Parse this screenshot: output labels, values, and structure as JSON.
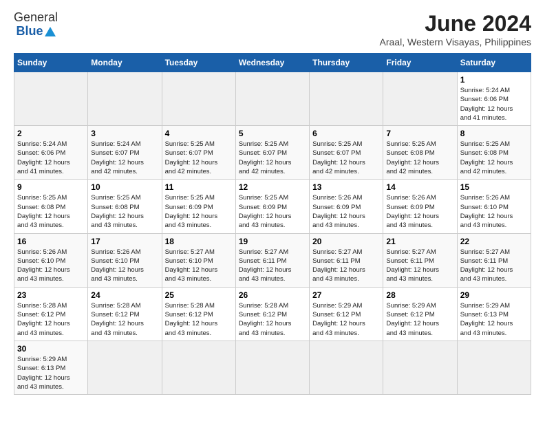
{
  "header": {
    "logo_general": "General",
    "logo_blue": "Blue",
    "title": "June 2024",
    "subtitle": "Araal, Western Visayas, Philippines"
  },
  "days_of_week": [
    "Sunday",
    "Monday",
    "Tuesday",
    "Wednesday",
    "Thursday",
    "Friday",
    "Saturday"
  ],
  "weeks": [
    {
      "days": [
        {
          "number": "",
          "empty": true
        },
        {
          "number": "",
          "empty": true
        },
        {
          "number": "",
          "empty": true
        },
        {
          "number": "",
          "empty": true
        },
        {
          "number": "",
          "empty": true
        },
        {
          "number": "",
          "empty": true
        },
        {
          "number": "1",
          "sunrise": "5:24 AM",
          "sunset": "6:06 PM",
          "daylight_hours": "12",
          "daylight_minutes": "41"
        }
      ]
    },
    {
      "days": [
        {
          "number": "2",
          "sunrise": "5:24 AM",
          "sunset": "6:06 PM",
          "daylight_hours": "12",
          "daylight_minutes": "41"
        },
        {
          "number": "3",
          "sunrise": "5:24 AM",
          "sunset": "6:07 PM",
          "daylight_hours": "12",
          "daylight_minutes": "42"
        },
        {
          "number": "4",
          "sunrise": "5:25 AM",
          "sunset": "6:07 PM",
          "daylight_hours": "12",
          "daylight_minutes": "42"
        },
        {
          "number": "5",
          "sunrise": "5:25 AM",
          "sunset": "6:07 PM",
          "daylight_hours": "12",
          "daylight_minutes": "42"
        },
        {
          "number": "6",
          "sunrise": "5:25 AM",
          "sunset": "6:07 PM",
          "daylight_hours": "12",
          "daylight_minutes": "42"
        },
        {
          "number": "7",
          "sunrise": "5:25 AM",
          "sunset": "6:08 PM",
          "daylight_hours": "12",
          "daylight_minutes": "42"
        },
        {
          "number": "8",
          "sunrise": "5:25 AM",
          "sunset": "6:08 PM",
          "daylight_hours": "12",
          "daylight_minutes": "42"
        }
      ]
    },
    {
      "days": [
        {
          "number": "9",
          "sunrise": "5:25 AM",
          "sunset": "6:08 PM",
          "daylight_hours": "12",
          "daylight_minutes": "43"
        },
        {
          "number": "10",
          "sunrise": "5:25 AM",
          "sunset": "6:08 PM",
          "daylight_hours": "12",
          "daylight_minutes": "43"
        },
        {
          "number": "11",
          "sunrise": "5:25 AM",
          "sunset": "6:09 PM",
          "daylight_hours": "12",
          "daylight_minutes": "43"
        },
        {
          "number": "12",
          "sunrise": "5:25 AM",
          "sunset": "6:09 PM",
          "daylight_hours": "12",
          "daylight_minutes": "43"
        },
        {
          "number": "13",
          "sunrise": "5:26 AM",
          "sunset": "6:09 PM",
          "daylight_hours": "12",
          "daylight_minutes": "43"
        },
        {
          "number": "14",
          "sunrise": "5:26 AM",
          "sunset": "6:09 PM",
          "daylight_hours": "12",
          "daylight_minutes": "43"
        },
        {
          "number": "15",
          "sunrise": "5:26 AM",
          "sunset": "6:10 PM",
          "daylight_hours": "12",
          "daylight_minutes": "43"
        }
      ]
    },
    {
      "days": [
        {
          "number": "16",
          "sunrise": "5:26 AM",
          "sunset": "6:10 PM",
          "daylight_hours": "12",
          "daylight_minutes": "43"
        },
        {
          "number": "17",
          "sunrise": "5:26 AM",
          "sunset": "6:10 PM",
          "daylight_hours": "12",
          "daylight_minutes": "43"
        },
        {
          "number": "18",
          "sunrise": "5:27 AM",
          "sunset": "6:10 PM",
          "daylight_hours": "12",
          "daylight_minutes": "43"
        },
        {
          "number": "19",
          "sunrise": "5:27 AM",
          "sunset": "6:11 PM",
          "daylight_hours": "12",
          "daylight_minutes": "43"
        },
        {
          "number": "20",
          "sunrise": "5:27 AM",
          "sunset": "6:11 PM",
          "daylight_hours": "12",
          "daylight_minutes": "43"
        },
        {
          "number": "21",
          "sunrise": "5:27 AM",
          "sunset": "6:11 PM",
          "daylight_hours": "12",
          "daylight_minutes": "43"
        },
        {
          "number": "22",
          "sunrise": "5:27 AM",
          "sunset": "6:11 PM",
          "daylight_hours": "12",
          "daylight_minutes": "43"
        }
      ]
    },
    {
      "days": [
        {
          "number": "23",
          "sunrise": "5:28 AM",
          "sunset": "6:12 PM",
          "daylight_hours": "12",
          "daylight_minutes": "43"
        },
        {
          "number": "24",
          "sunrise": "5:28 AM",
          "sunset": "6:12 PM",
          "daylight_hours": "12",
          "daylight_minutes": "43"
        },
        {
          "number": "25",
          "sunrise": "5:28 AM",
          "sunset": "6:12 PM",
          "daylight_hours": "12",
          "daylight_minutes": "43"
        },
        {
          "number": "26",
          "sunrise": "5:28 AM",
          "sunset": "6:12 PM",
          "daylight_hours": "12",
          "daylight_minutes": "43"
        },
        {
          "number": "27",
          "sunrise": "5:29 AM",
          "sunset": "6:12 PM",
          "daylight_hours": "12",
          "daylight_minutes": "43"
        },
        {
          "number": "28",
          "sunrise": "5:29 AM",
          "sunset": "6:12 PM",
          "daylight_hours": "12",
          "daylight_minutes": "43"
        },
        {
          "number": "29",
          "sunrise": "5:29 AM",
          "sunset": "6:13 PM",
          "daylight_hours": "12",
          "daylight_minutes": "43"
        }
      ]
    },
    {
      "days": [
        {
          "number": "30",
          "sunrise": "5:29 AM",
          "sunset": "6:13 PM",
          "daylight_hours": "12",
          "daylight_minutes": "43"
        },
        {
          "number": "",
          "empty": true
        },
        {
          "number": "",
          "empty": true
        },
        {
          "number": "",
          "empty": true
        },
        {
          "number": "",
          "empty": true
        },
        {
          "number": "",
          "empty": true
        },
        {
          "number": "",
          "empty": true
        }
      ]
    }
  ],
  "labels": {
    "sunrise": "Sunrise:",
    "sunset": "Sunset:",
    "daylight": "Daylight: 12 hours"
  }
}
